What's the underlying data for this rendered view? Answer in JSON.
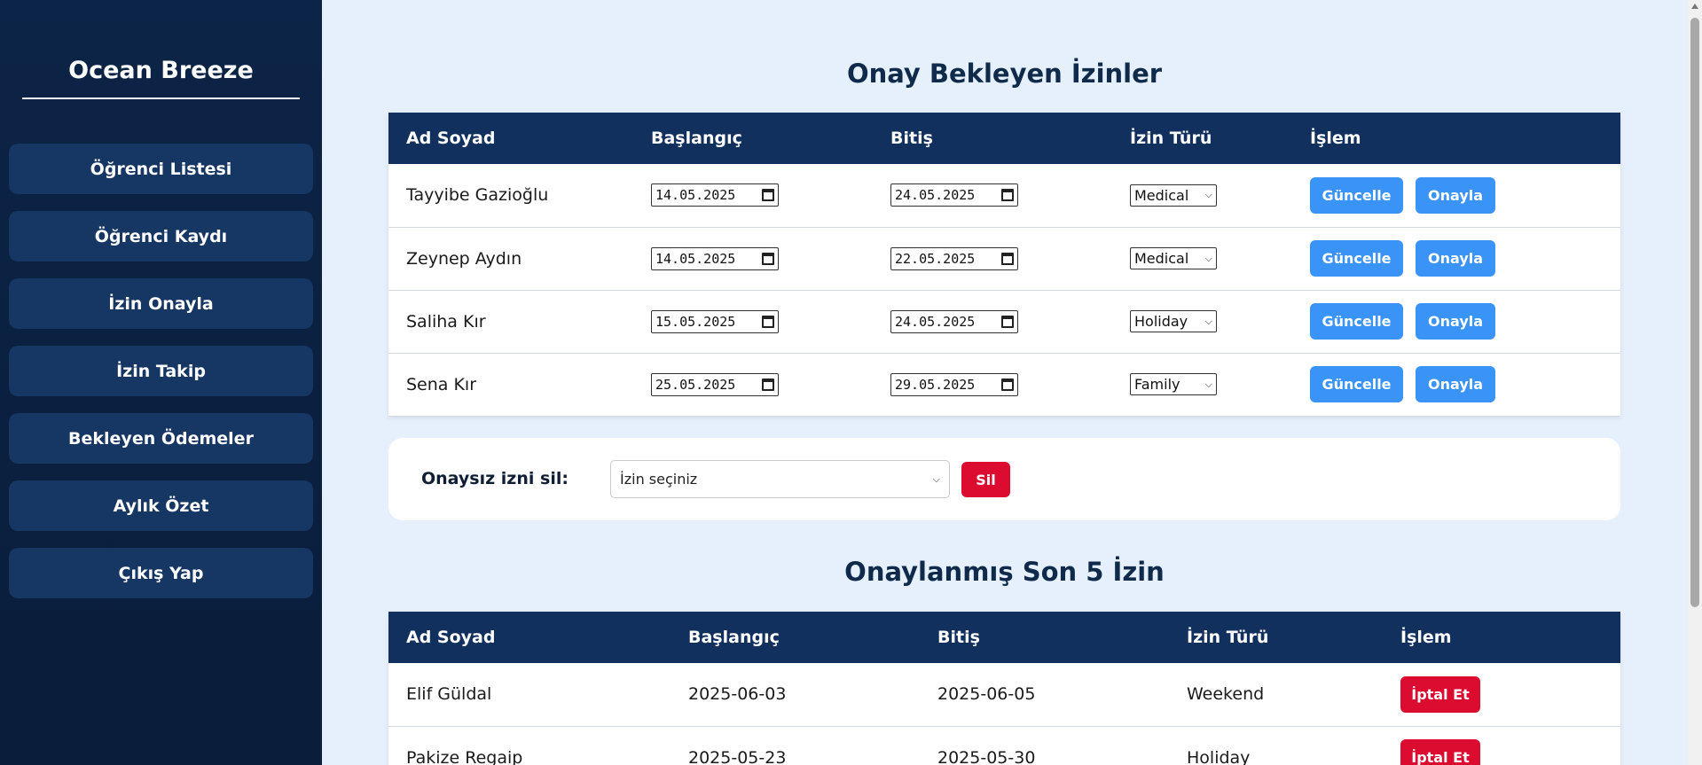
{
  "sidebar": {
    "brand": "Ocean Breeze",
    "items": [
      {
        "label": "Öğrenci Listesi"
      },
      {
        "label": "Öğrenci Kaydı"
      },
      {
        "label": "İzin Onayla"
      },
      {
        "label": "İzin Takip"
      },
      {
        "label": "Bekleyen Ödemeler"
      },
      {
        "label": "Aylık Özet"
      },
      {
        "label": "Çıkış Yap"
      }
    ]
  },
  "pending": {
    "title": "Onay Bekleyen İzinler",
    "headers": {
      "name": "Ad Soyad",
      "start": "Başlangıç",
      "end": "Bitiş",
      "type": "İzin Türü",
      "action": "İşlem"
    },
    "update_label": "Güncelle",
    "approve_label": "Onayla",
    "rows": [
      {
        "name": "Tayyibe Gazioğlu",
        "start": "14.05.2025",
        "end": "24.05.2025",
        "type": "Medical"
      },
      {
        "name": "Zeynep Aydın",
        "start": "14.05.2025",
        "end": "22.05.2025",
        "type": "Medical"
      },
      {
        "name": "Saliha Kır",
        "start": "15.05.2025",
        "end": "24.05.2025",
        "type": "Holiday"
      },
      {
        "name": "Sena Kır",
        "start": "25.05.2025",
        "end": "29.05.2025",
        "type": "Family"
      }
    ]
  },
  "delete_unapproved": {
    "label": "Onaysız izni sil:",
    "select_value": "İzin seçiniz",
    "button": "Sil"
  },
  "approved": {
    "title": "Onaylanmış Son 5 İzin",
    "headers": {
      "name": "Ad Soyad",
      "start": "Başlangıç",
      "end": "Bitiş",
      "type": "İzin Türü",
      "action": "İşlem"
    },
    "cancel_label": "İptal Et",
    "rows": [
      {
        "name": "Elif Güldal",
        "start": "2025-06-03",
        "end": "2025-06-05",
        "type": "Weekend"
      },
      {
        "name": "Pakize Regaip",
        "start": "2025-05-23",
        "end": "2025-05-30",
        "type": "Holiday"
      }
    ]
  },
  "colors": {
    "sidebar_bg": "#0c2447",
    "nav_item_bg": "#163663",
    "table_header_bg": "#12305e",
    "page_bg": "#e6f0fd",
    "primary_button": "#3a93f6",
    "danger_button": "#dc0c30"
  }
}
